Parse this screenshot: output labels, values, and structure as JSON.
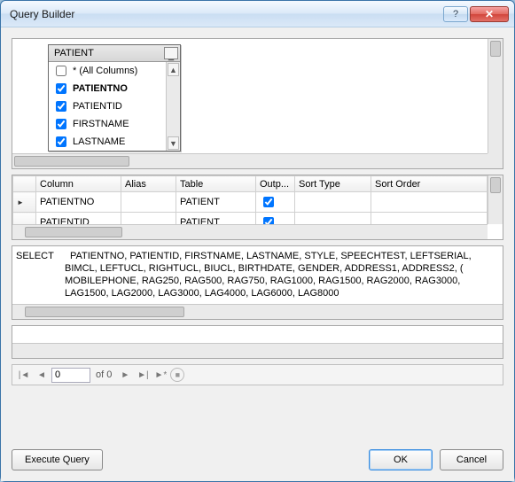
{
  "window": {
    "title": "Query Builder"
  },
  "tablebox": {
    "name": "PATIENT",
    "columns": [
      {
        "label": "* (All Columns)",
        "checked": false,
        "bold": false
      },
      {
        "label": "PATIENTNO",
        "checked": true,
        "bold": true
      },
      {
        "label": "PATIENTID",
        "checked": true,
        "bold": false
      },
      {
        "label": "FIRSTNAME",
        "checked": true,
        "bold": false
      },
      {
        "label": "LASTNAME",
        "checked": true,
        "bold": false
      }
    ]
  },
  "grid": {
    "headers": {
      "column": "Column",
      "alias": "Alias",
      "table": "Table",
      "output": "Outp...",
      "sortType": "Sort Type",
      "sortOrder": "Sort Order"
    },
    "rows": [
      {
        "column": "PATIENTNO",
        "alias": "",
        "table": "PATIENT",
        "output": true,
        "sortType": "",
        "sortOrder": ""
      },
      {
        "column": "PATIENTID",
        "alias": "",
        "table": "PATIENT",
        "output": true,
        "sortType": "",
        "sortOrder": ""
      }
    ]
  },
  "sql": {
    "keyword": "SELECT",
    "line1": "PATIENTNO, PATIENTID, FIRSTNAME, LASTNAME, STYLE, SPEECHTEST, LEFTSERIAL,",
    "line2": "BIMCL, LEFTUCL, RIGHTUCL, BIUCL, BIRTHDATE, GENDER, ADDRESS1, ADDRESS2, (",
    "line3": "MOBILEPHONE, RAG250, RAG500, RAG750, RAG1000, RAG1500, RAG2000, RAG3000,",
    "line4": "LAG1500, LAG2000, LAG3000, LAG4000, LAG6000, LAG8000"
  },
  "navigator": {
    "position": "0",
    "of_label": "of 0"
  },
  "buttons": {
    "execute": "Execute Query",
    "ok": "OK",
    "cancel": "Cancel"
  }
}
